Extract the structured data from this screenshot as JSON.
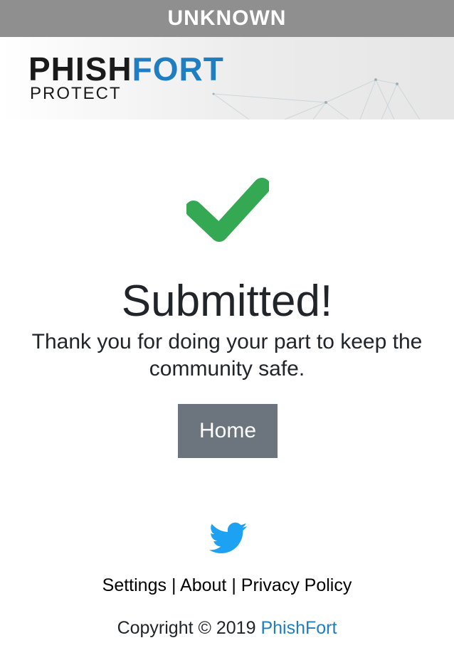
{
  "status_bar": {
    "label": "UNKNOWN",
    "color": "#8f8f8f"
  },
  "header": {
    "logo_part1": "PHISH",
    "logo_part2": "FORT",
    "logo_sub": "PROTECT",
    "brand_color": "#1f7ec2"
  },
  "main": {
    "icon": "check-icon",
    "icon_color": "#34a853",
    "title": "Submitted!",
    "message": "Thank you for doing your part to keep the community safe.",
    "home_button": "Home"
  },
  "footer": {
    "social_icon": "twitter-icon",
    "links": [
      "Settings",
      "About",
      "Privacy Policy"
    ],
    "separator": "|",
    "copyright_prefix": "Copyright © 2019",
    "copyright_link": "PhishFort"
  }
}
